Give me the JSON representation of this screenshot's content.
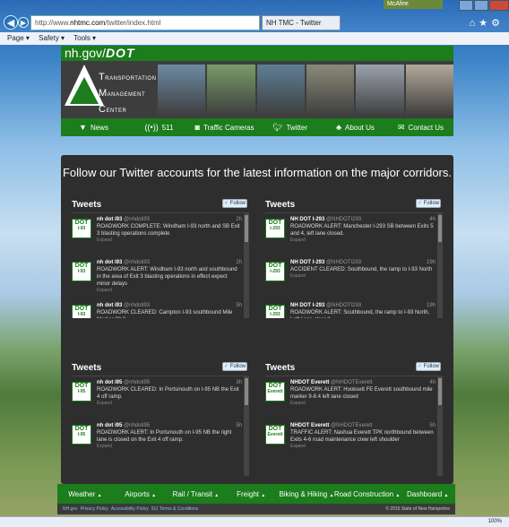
{
  "browser": {
    "url_prefix": "http://www.",
    "url_domain": "nhtmc.com",
    "url_path": "/twitter/index.html",
    "tab_title": "NH TMC - Twitter",
    "mcafee": "McAfee",
    "zoom": "100%",
    "cmd": [
      "Page ▾",
      "Safety ▾",
      "Tools ▾"
    ]
  },
  "header": {
    "site": "nh.gov/",
    "site_dot": "DOT",
    "logo_lines": [
      {
        "cap": "T",
        "rest": "RANSPORTATION"
      },
      {
        "cap": "M",
        "rest": "ANAGEMENT"
      },
      {
        "cap": "C",
        "rest": "ENTER"
      }
    ],
    "photo_colors": [
      "#6d8aa3",
      "#7a9a6a",
      "#5f7f95",
      "#8a8a7a",
      "#9aa2ac",
      "#b3a89a"
    ]
  },
  "nav": [
    {
      "label": "News",
      "icon": "car-icon"
    },
    {
      "label": "511",
      "icon": "radio-icon"
    },
    {
      "label": "Traffic Cameras",
      "icon": "camera-icon"
    },
    {
      "label": "Twitter",
      "icon": "twitter-bird-icon"
    },
    {
      "label": "About Us",
      "icon": "people-icon"
    },
    {
      "label": "Contact Us",
      "icon": "envelope-icon"
    }
  ],
  "panel": {
    "headline": "Follow our Twitter accounts for the latest information on the major corridors.",
    "tweets_label": "Tweets",
    "follow_label": "Follow",
    "expand_label": "Expand"
  },
  "feeds": [
    {
      "avatar": "I-93",
      "tweets": [
        {
          "name": "nh dot i93",
          "handle": "@nhdoti93",
          "time": "2h",
          "text": "ROADWORK COMPLETE: Windham I-93 north and SB Exit 3 blasting operations complete"
        },
        {
          "name": "nh dot i93",
          "handle": "@nhdoti93",
          "time": "2h",
          "text": "ROADWORK ALERT: Windham I-93 north and southbound in the area of Exit 3 blasting operations in effect expect minor delays"
        },
        {
          "name": "nh dot i93",
          "handle": "@nhdoti93",
          "time": "5h",
          "text": "ROADWORK CLEARED: Campton I-93 southbound Mile Marker 82.8"
        }
      ]
    },
    {
      "avatar": "I-293",
      "tweets": [
        {
          "name": "NH DOT I-293",
          "handle": "@NHDOTI293",
          "time": "4h",
          "text": "ROADWORK ALERT: Manchester I-293 SB between Exits 5 and 4, left lane closed."
        },
        {
          "name": "NH DOT I-293",
          "handle": "@NHDOTI293",
          "time": "19h",
          "text": "ACCIDENT CLEARED: Southbound, the ramp to I-93 North"
        },
        {
          "name": "NH DOT I-293",
          "handle": "@NHDOTI293",
          "time": "19h",
          "text": "ROADWORK ALERT: Southbound, the ramp to I-93 North, Left Lane closed."
        }
      ]
    },
    {
      "avatar": "I-95",
      "tweets": [
        {
          "name": "nh dot i95",
          "handle": "@nhdoti95",
          "time": "3h",
          "text": "ROADWORK CLEARED: In Portsmouth on I-95 NB  the Exit 4 off ramp."
        },
        {
          "name": "nh dot i95",
          "handle": "@nhdoti95",
          "time": "5h",
          "text": "ROADWORK ALERT: In Portsmouth on I-95 NB the right lane is closed on the Exit 4 off ramp."
        }
      ]
    },
    {
      "avatar": "Everett",
      "tweets": [
        {
          "name": "NHDOT Everett",
          "handle": "@NHDOTEverett",
          "time": "4h",
          "text": "ROADWORK ALERT: Hooksett FE Everett southbound mile marker 9-8.4 left lane closed"
        },
        {
          "name": "NHDOT Everett",
          "handle": "@NHDOTEverett",
          "time": "5h",
          "text": "TRAFFIC ALERT: Nashua Everett TPK northbound between Exits 4-6 road maintenance crew left shoulder"
        }
      ]
    }
  ],
  "bottom_nav": [
    "Weather",
    "Airports",
    "Rail / Transit",
    "Freight",
    "Biking & Hiking",
    "Road Construction",
    "Dashboard"
  ],
  "footer": {
    "links": [
      "NH.gov",
      "Privacy Policy",
      "Accessibility Policy",
      "911 Terms & Conditions"
    ],
    "copyright": "© 2015 State of New Hampshire"
  }
}
